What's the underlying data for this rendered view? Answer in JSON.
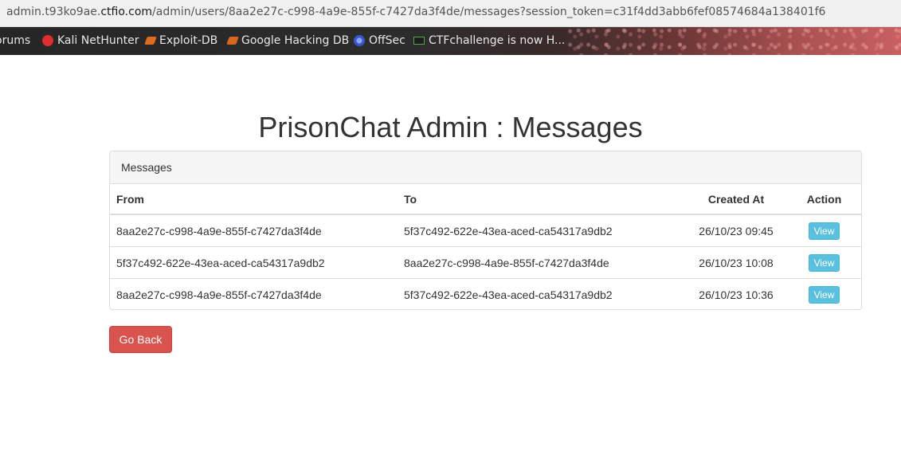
{
  "browser": {
    "url_host": "admin.t93ko9ae.ctfio.com",
    "url_host_prefix": "admin.t93ko9ae.",
    "url_host_domain": "ctfio.com",
    "url_path": "/admin/users/8aa2e27c-c998-4a9e-855f-c7427da3f4de/messages?session_token=c31f4dd3abb6fef08574684a138401f6",
    "bookmarks": [
      {
        "label": "orums",
        "icon": ""
      },
      {
        "label": "Kali NetHunter",
        "icon": "kali-dragon-icon"
      },
      {
        "label": "Exploit-DB",
        "icon": "exploit-db-icon"
      },
      {
        "label": "Google Hacking DB",
        "icon": "ghdb-icon"
      },
      {
        "label": "OffSec",
        "icon": "offsec-icon"
      },
      {
        "label": "CTFchallenge is now H...",
        "icon": "terminal-icon"
      }
    ]
  },
  "page": {
    "title": "PrisonChat Admin : Messages",
    "panel_heading": "Messages",
    "columns": {
      "from": "From",
      "to": "To",
      "created_at": "Created At",
      "action": "Action"
    },
    "rows": [
      {
        "from": "8aa2e27c-c998-4a9e-855f-c7427da3f4de",
        "to": "5f37c492-622e-43ea-aced-ca54317a9db2",
        "created_at": "26/10/23 09:45",
        "action": "View"
      },
      {
        "from": "5f37c492-622e-43ea-aced-ca54317a9db2",
        "to": "8aa2e27c-c998-4a9e-855f-c7427da3f4de",
        "created_at": "26/10/23 10:08",
        "action": "View"
      },
      {
        "from": "8aa2e27c-c998-4a9e-855f-c7427da3f4de",
        "to": "5f37c492-622e-43ea-aced-ca54317a9db2",
        "created_at": "26/10/23 10:36",
        "action": "View"
      }
    ],
    "back_button": "Go Back"
  },
  "colors": {
    "view_button": "#5bc0de",
    "back_button": "#d9534f",
    "text": "#333333"
  }
}
